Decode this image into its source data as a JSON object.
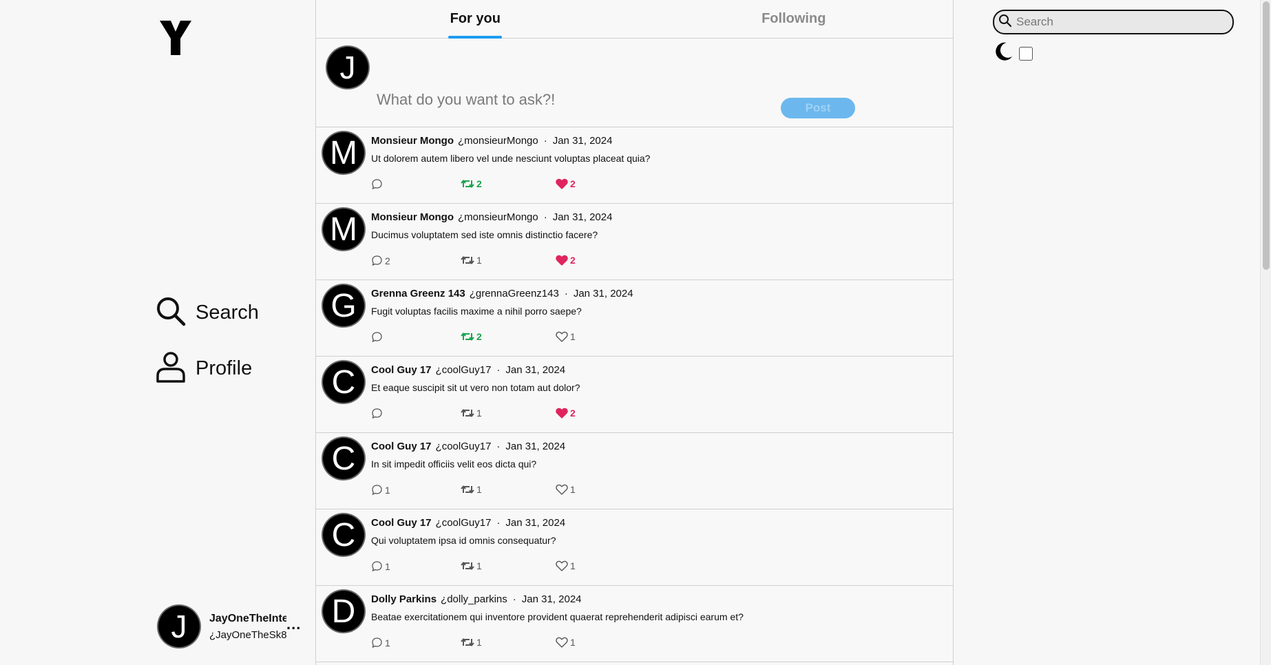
{
  "nav": {
    "search_label": "Search",
    "profile_label": "Profile"
  },
  "account": {
    "avatar_letter": "J",
    "display_name": "JayOneTheInternet",
    "handle": "¿JayOneTheSk8",
    "more": "..."
  },
  "tabs": {
    "for_you": "For you",
    "following": "Following"
  },
  "compose": {
    "avatar_letter": "J",
    "placeholder": "What do you want to ask?!",
    "post_label": "Post"
  },
  "posts": [
    {
      "letter": "M",
      "name": "Monsieur Mongo",
      "handle": "¿monsieurMongo",
      "date": "Jan 31, 2024",
      "text": "Ut dolorem autem libero vel unde nesciunt voluptas placeat quia?",
      "replies": "",
      "reposts": "2",
      "likes": "2",
      "reposted": true,
      "liked": true
    },
    {
      "letter": "M",
      "name": "Monsieur Mongo",
      "handle": "¿monsieurMongo",
      "date": "Jan 31, 2024",
      "text": "Ducimus voluptatem sed iste omnis distinctio facere?",
      "replies": "2",
      "reposts": "1",
      "likes": "2",
      "reposted": false,
      "liked": true
    },
    {
      "letter": "G",
      "name": "Grenna Greenz 143",
      "handle": "¿grennaGreenz143",
      "date": "Jan 31, 2024",
      "text": "Fugit voluptas facilis maxime a nihil porro saepe?",
      "replies": "",
      "reposts": "2",
      "likes": "1",
      "reposted": true,
      "liked": false
    },
    {
      "letter": "C",
      "name": "Cool Guy 17",
      "handle": "¿coolGuy17",
      "date": "Jan 31, 2024",
      "text": "Et eaque suscipit sit ut vero non totam aut dolor?",
      "replies": "",
      "reposts": "1",
      "likes": "2",
      "reposted": false,
      "liked": true
    },
    {
      "letter": "C",
      "name": "Cool Guy 17",
      "handle": "¿coolGuy17",
      "date": "Jan 31, 2024",
      "text": "In sit impedit officiis velit eos dicta qui?",
      "replies": "1",
      "reposts": "1",
      "likes": "1",
      "reposted": false,
      "liked": false
    },
    {
      "letter": "C",
      "name": "Cool Guy 17",
      "handle": "¿coolGuy17",
      "date": "Jan 31, 2024",
      "text": "Qui voluptatem ipsa id omnis consequatur?",
      "replies": "1",
      "reposts": "1",
      "likes": "1",
      "reposted": false,
      "liked": false
    },
    {
      "letter": "D",
      "name": "Dolly Parkins",
      "handle": "¿dolly_parkins",
      "date": "Jan 31, 2024",
      "text": "Beatae exercitationem qui inventore provident quaerat reprehenderit adipisci earum et?",
      "replies": "1",
      "reposts": "1",
      "likes": "1",
      "reposted": false,
      "liked": false
    }
  ],
  "search": {
    "placeholder": "Search"
  },
  "colors": {
    "accent": "#1d9bf0",
    "repost_active": "#17a34a",
    "like_active": "#e0245e"
  },
  "icons": [
    "y-logo-icon",
    "search-icon",
    "person-icon",
    "moon-icon",
    "reply-icon",
    "repost-icon",
    "heart-icon"
  ]
}
